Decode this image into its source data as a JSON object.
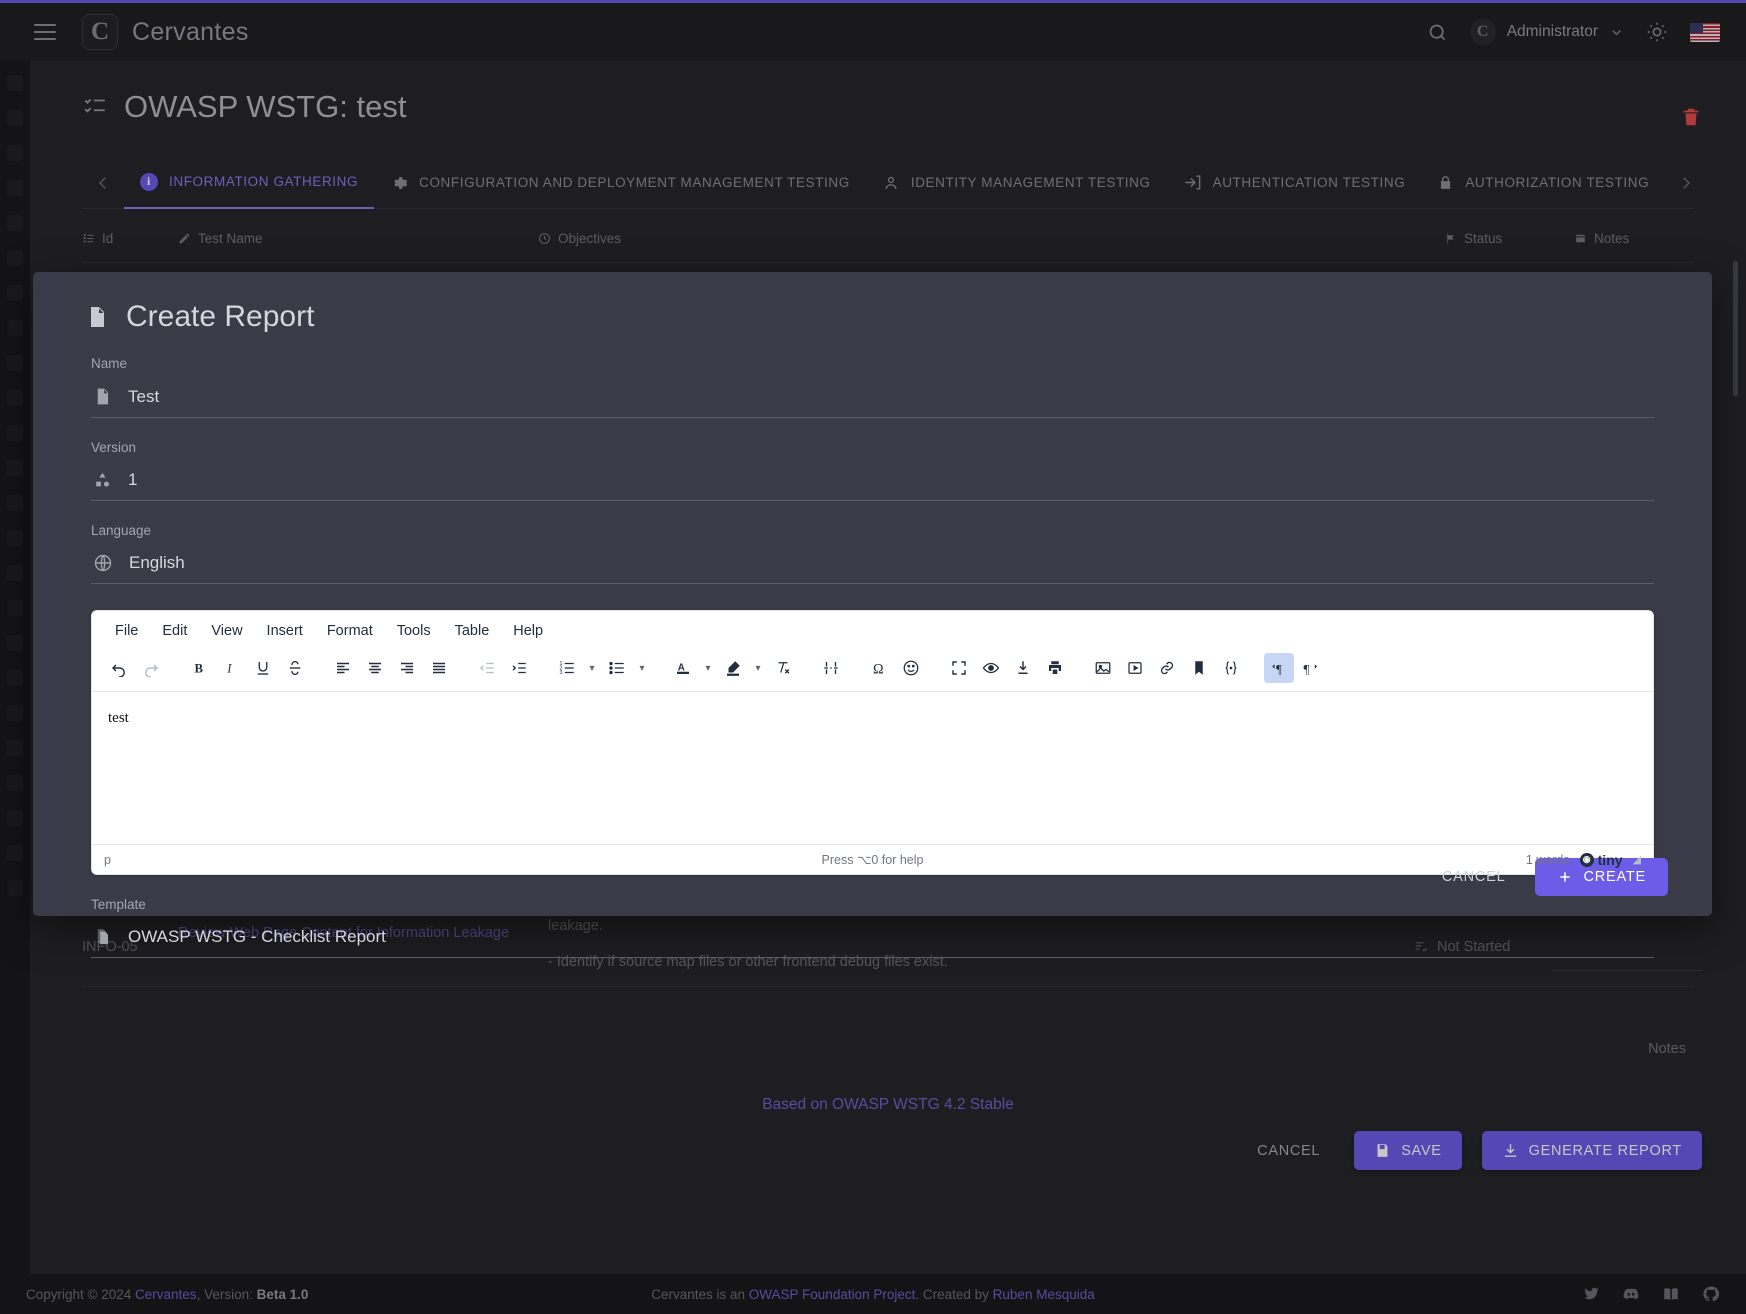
{
  "theme": {
    "accent": "#6d5ce7",
    "bg": "#1a1a1d",
    "panel": "#27272c",
    "modal": "#3b3b47",
    "danger": "#e04b4b"
  },
  "appbar": {
    "menu_icon": "hamburger-icon",
    "brand": "Cervantes",
    "brand_logo": "C",
    "search_icon": "search-icon",
    "user": "Administrator",
    "user_avatar": "C",
    "caret_icon": "chevron-down-icon",
    "theme_icon": "sun-icon",
    "flag_icon": "us-flag-icon"
  },
  "page": {
    "title": "OWASP WSTG: test",
    "title_icon": "checklist-icon",
    "delete_icon": "trash-icon",
    "prev_arrow": "chevron-left-icon",
    "next_arrow": "chevron-right-icon",
    "tabs": [
      {
        "label": "INFORMATION GATHERING",
        "icon": "info-icon",
        "active": true
      },
      {
        "label": "CONFIGURATION AND DEPLOYMENT MANAGEMENT TESTING",
        "icon": "gear-icon",
        "active": false
      },
      {
        "label": "IDENTITY MANAGEMENT TESTING",
        "icon": "person-icon",
        "active": false
      },
      {
        "label": "AUTHENTICATION TESTING",
        "icon": "login-icon",
        "active": false
      },
      {
        "label": "AUTHORIZATION TESTING",
        "icon": "lock-icon",
        "active": false
      }
    ],
    "columns": [
      {
        "label": "Id",
        "icon": "id-icon"
      },
      {
        "label": "Test Name",
        "icon": "pencil-icon"
      },
      {
        "label": "Objectives",
        "icon": "target-icon"
      },
      {
        "label": "Status",
        "icon": "flag-icon"
      },
      {
        "label": "Notes",
        "icon": "note-icon"
      }
    ],
    "row": {
      "id": "INFO-05",
      "name": "Review Web Page Content for Information Leakage",
      "objective_lines": [
        "leakage.",
        "- Identify if source map files or other frontend debug files exist."
      ],
      "status": "Not Started",
      "status_icon": "status-icon",
      "notes_label": "Notes"
    },
    "based_on": "Based on OWASP WSTG 4.2 Stable",
    "actions": {
      "cancel": "CANCEL",
      "save": "SAVE",
      "save_icon": "save-icon",
      "generate": "GENERATE REPORT",
      "generate_icon": "download-icon"
    }
  },
  "modal": {
    "title": "Create Report",
    "title_icon": "pdf-file-icon",
    "fields": {
      "name": {
        "label": "Name",
        "value": "Test",
        "icon": "pdf-file-icon"
      },
      "version": {
        "label": "Version",
        "value": "1",
        "icon": "shapes-icon"
      },
      "language": {
        "label": "Language",
        "value": "English",
        "icon": "globe-icon"
      },
      "template": {
        "label": "Template",
        "value": "OWASP WSTG - Checklist Report",
        "icon": "copy-file-icon"
      }
    },
    "editor": {
      "menus": [
        "File",
        "Edit",
        "View",
        "Insert",
        "Format",
        "Tools",
        "Table",
        "Help"
      ],
      "toolbar": [
        {
          "name": "undo-icon",
          "state": "normal"
        },
        {
          "name": "redo-icon",
          "state": "disabled"
        },
        {
          "name": "separator"
        },
        {
          "name": "bold-icon",
          "state": "normal"
        },
        {
          "name": "italic-icon",
          "state": "normal"
        },
        {
          "name": "underline-icon",
          "state": "normal"
        },
        {
          "name": "strikethrough-icon",
          "state": "normal"
        },
        {
          "name": "separator"
        },
        {
          "name": "align-left-icon",
          "state": "normal"
        },
        {
          "name": "align-center-icon",
          "state": "normal"
        },
        {
          "name": "align-right-icon",
          "state": "normal"
        },
        {
          "name": "align-justify-icon",
          "state": "normal"
        },
        {
          "name": "separator"
        },
        {
          "name": "outdent-icon",
          "state": "disabled"
        },
        {
          "name": "indent-icon",
          "state": "normal"
        },
        {
          "name": "separator"
        },
        {
          "name": "numbered-list-icon",
          "state": "normal"
        },
        {
          "name": "chevron-down-icon",
          "state": "chev"
        },
        {
          "name": "bullet-list-icon",
          "state": "normal"
        },
        {
          "name": "chevron-down-icon",
          "state": "chev"
        },
        {
          "name": "separator"
        },
        {
          "name": "text-color-icon",
          "state": "normal"
        },
        {
          "name": "chevron-down-icon",
          "state": "chev"
        },
        {
          "name": "highlight-color-icon",
          "state": "normal"
        },
        {
          "name": "chevron-down-icon",
          "state": "chev"
        },
        {
          "name": "clear-formatting-icon",
          "state": "normal"
        },
        {
          "name": "separator"
        },
        {
          "name": "page-break-icon",
          "state": "normal"
        },
        {
          "name": "separator"
        },
        {
          "name": "special-character-icon",
          "state": "normal"
        },
        {
          "name": "emoticon-icon",
          "state": "normal"
        },
        {
          "name": "separator"
        },
        {
          "name": "fullscreen-icon",
          "state": "normal"
        },
        {
          "name": "preview-icon",
          "state": "normal"
        },
        {
          "name": "export-icon",
          "state": "normal"
        },
        {
          "name": "print-icon",
          "state": "normal"
        },
        {
          "name": "separator"
        },
        {
          "name": "insert-image-icon",
          "state": "normal"
        },
        {
          "name": "insert-media-icon",
          "state": "normal"
        },
        {
          "name": "insert-link-icon",
          "state": "normal"
        },
        {
          "name": "bookmark-icon",
          "state": "normal"
        },
        {
          "name": "source-code-icon",
          "state": "normal"
        },
        {
          "name": "separator"
        },
        {
          "name": "ltr-icon",
          "state": "active"
        },
        {
          "name": "rtl-icon",
          "state": "normal"
        }
      ],
      "content": "test",
      "status_path": "p",
      "status_help": "Press ⌥0 for help",
      "word_count": "1 words",
      "branding": "tiny"
    },
    "actions": {
      "cancel": "CANCEL",
      "create": "CREATE",
      "create_icon": "plus-icon"
    }
  },
  "footer": {
    "copyright": "Copyright © 2024",
    "brand": "Cervantes",
    "version_label": ", Version:",
    "version": "Beta 1.0",
    "center_pre": "Cervantes is an ",
    "center_link": "OWASP Foundation Project",
    "center_mid": ". Created by ",
    "center_author": "Ruben Mesquida",
    "icons": [
      "twitter-icon",
      "discord-icon",
      "docs-icon",
      "github-icon"
    ]
  }
}
